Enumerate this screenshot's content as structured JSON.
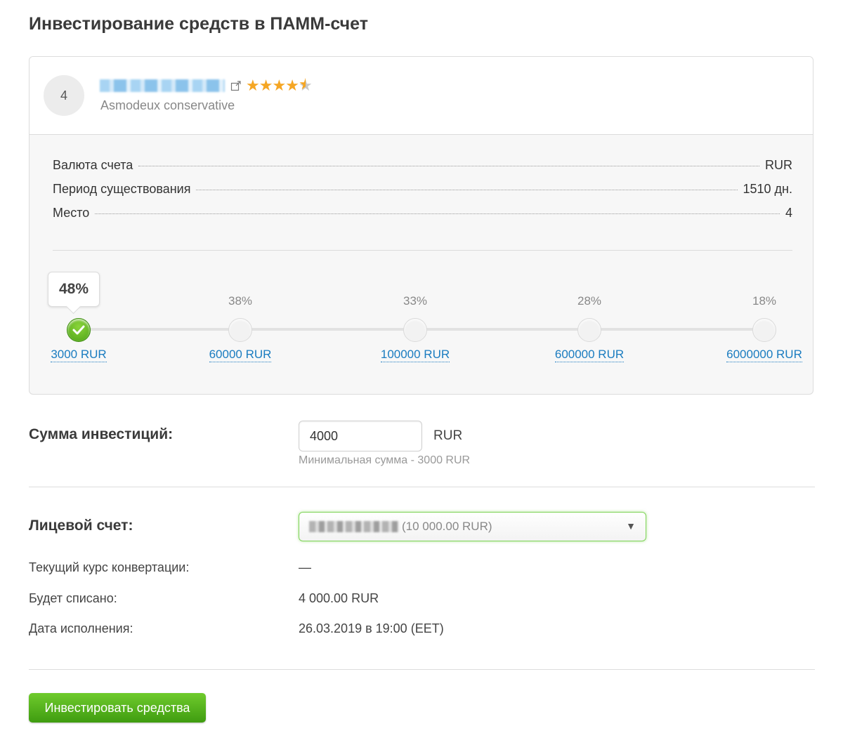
{
  "page": {
    "title": "Инвестирование средств в ПАММ-счет"
  },
  "account": {
    "rank": "4",
    "strategy_name": "Asmodeux conservative",
    "rating_stars": 4.5,
    "info": [
      {
        "label": "Валюта счета",
        "value": "RUR"
      },
      {
        "label": "Период существования",
        "value": "1510 дн."
      },
      {
        "label": "Место",
        "value": "4"
      }
    ]
  },
  "tiers": [
    {
      "percent": "48%",
      "amount": "3000 RUR",
      "active": true
    },
    {
      "percent": "38%",
      "amount": "60000 RUR",
      "active": false
    },
    {
      "percent": "33%",
      "amount": "100000 RUR",
      "active": false
    },
    {
      "percent": "28%",
      "amount": "600000 RUR",
      "active": false
    },
    {
      "percent": "18%",
      "amount": "6000000 RUR",
      "active": false
    }
  ],
  "form": {
    "amount_label": "Сумма инвестиций:",
    "amount_value": "4000",
    "amount_currency": "RUR",
    "amount_hint": "Минимальная сумма - 3000 RUR",
    "account_label": "Лицевой счет:",
    "account_balance": "(10 000.00 RUR)",
    "details": [
      {
        "label": "Текущий курс конвертации:",
        "value": "—"
      },
      {
        "label": "Будет списано:",
        "value": "4 000.00 RUR"
      },
      {
        "label": "Дата исполнения:",
        "value": "26.03.2019 в 19:00 (EET)"
      }
    ],
    "submit_label": "Инвестировать средства"
  },
  "colors": {
    "accent_green": "#4ea317",
    "link_blue": "#1a7cc0",
    "star": "#f5a623"
  }
}
